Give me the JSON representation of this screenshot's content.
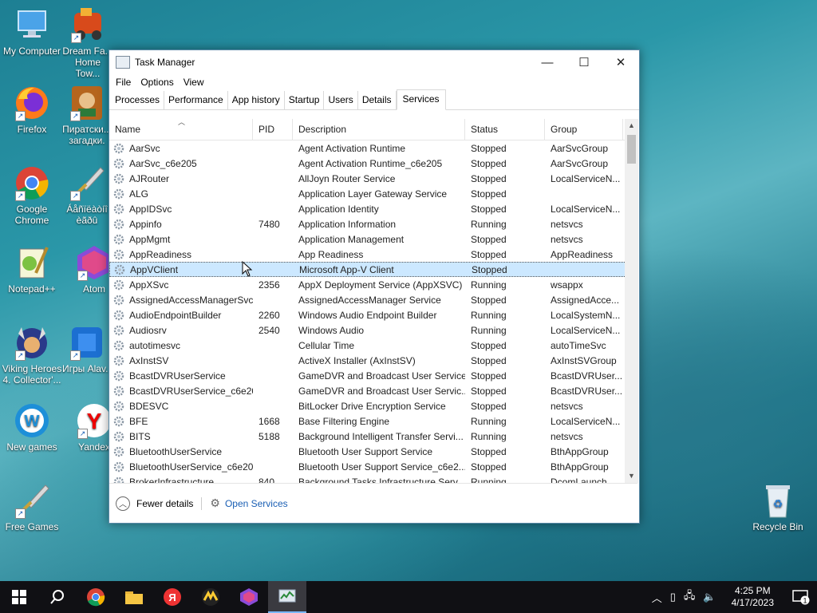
{
  "desktop": {
    "icons": [
      {
        "label": "My Computer",
        "icon": "computer-icon"
      },
      {
        "label": "Dream Fa... Home Tow...",
        "icon": "game-icon"
      },
      {
        "label": "Firefox",
        "icon": "firefox-icon"
      },
      {
        "label": "Пиратски... загадки.",
        "icon": "game-icon"
      },
      {
        "label": "Google Chrome",
        "icon": "chrome-icon"
      },
      {
        "label": "Áåñïëàòíî èãðû",
        "icon": "sword-icon"
      },
      {
        "label": "Notepad++",
        "icon": "notepad-icon"
      },
      {
        "label": "Atom",
        "icon": "atom-icon"
      },
      {
        "label": "Viking Heroes 4. Collector'...",
        "icon": "game-icon"
      },
      {
        "label": "Игры Alav...",
        "icon": "game-icon"
      },
      {
        "label": "New games",
        "icon": "w-icon"
      },
      {
        "label": "Yandex",
        "icon": "yandex-icon"
      },
      {
        "label": "Free Games",
        "icon": "sword-icon"
      },
      {
        "label": "Recycle Bin",
        "icon": "recycle-bin-icon"
      }
    ]
  },
  "window": {
    "title": "Task Manager",
    "menu": [
      "File",
      "Options",
      "View"
    ],
    "tabs": [
      "Processes",
      "Performance",
      "App history",
      "Startup",
      "Users",
      "Details",
      "Services"
    ],
    "active_tab": "Services",
    "columns": [
      "Name",
      "PID",
      "Description",
      "Status",
      "Group"
    ],
    "rows": [
      [
        "AarSvc",
        "",
        "Agent Activation Runtime",
        "Stopped",
        "AarSvcGroup"
      ],
      [
        "AarSvc_c6e205",
        "",
        "Agent Activation Runtime_c6e205",
        "Stopped",
        "AarSvcGroup"
      ],
      [
        "AJRouter",
        "",
        "AllJoyn Router Service",
        "Stopped",
        "LocalServiceN..."
      ],
      [
        "ALG",
        "",
        "Application Layer Gateway Service",
        "Stopped",
        ""
      ],
      [
        "AppIDSvc",
        "",
        "Application Identity",
        "Stopped",
        "LocalServiceN..."
      ],
      [
        "Appinfo",
        "7480",
        "Application Information",
        "Running",
        "netsvcs"
      ],
      [
        "AppMgmt",
        "",
        "Application Management",
        "Stopped",
        "netsvcs"
      ],
      [
        "AppReadiness",
        "",
        "App Readiness",
        "Stopped",
        "AppReadiness"
      ],
      [
        "AppVClient",
        "",
        "Microsoft App-V Client",
        "Stopped",
        ""
      ],
      [
        "AppXSvc",
        "2356",
        "AppX Deployment Service (AppXSVC)",
        "Running",
        "wsappx"
      ],
      [
        "AssignedAccessManagerSvc",
        "",
        "AssignedAccessManager Service",
        "Stopped",
        "AssignedAcce..."
      ],
      [
        "AudioEndpointBuilder",
        "2260",
        "Windows Audio Endpoint Builder",
        "Running",
        "LocalSystemN..."
      ],
      [
        "Audiosrv",
        "2540",
        "Windows Audio",
        "Running",
        "LocalServiceN..."
      ],
      [
        "autotimesvc",
        "",
        "Cellular Time",
        "Stopped",
        "autoTimeSvc"
      ],
      [
        "AxInstSV",
        "",
        "ActiveX Installer (AxInstSV)",
        "Stopped",
        "AxInstSVGroup"
      ],
      [
        "BcastDVRUserService",
        "",
        "GameDVR and Broadcast User Service",
        "Stopped",
        "BcastDVRUser..."
      ],
      [
        "BcastDVRUserService_c6e205",
        "",
        "GameDVR and Broadcast User Servic...",
        "Stopped",
        "BcastDVRUser..."
      ],
      [
        "BDESVC",
        "",
        "BitLocker Drive Encryption Service",
        "Stopped",
        "netsvcs"
      ],
      [
        "BFE",
        "1668",
        "Base Filtering Engine",
        "Running",
        "LocalServiceN..."
      ],
      [
        "BITS",
        "5188",
        "Background Intelligent Transfer Servi...",
        "Running",
        "netsvcs"
      ],
      [
        "BluetoothUserService",
        "",
        "Bluetooth User Support Service",
        "Stopped",
        "BthAppGroup"
      ],
      [
        "BluetoothUserService_c6e205",
        "",
        "Bluetooth User Support Service_c6e2...",
        "Stopped",
        "BthAppGroup"
      ],
      [
        "BrokerInfrastructure",
        "840",
        "Background Tasks Infrastructure Serv...",
        "Running",
        "DcomLaunch"
      ]
    ],
    "selected_row": 8,
    "footer": {
      "fewer_details": "Fewer details",
      "open_services": "Open Services"
    }
  },
  "taskbar": {
    "time": "4:25 PM",
    "date": "4/17/2023",
    "notification_count": "1"
  }
}
